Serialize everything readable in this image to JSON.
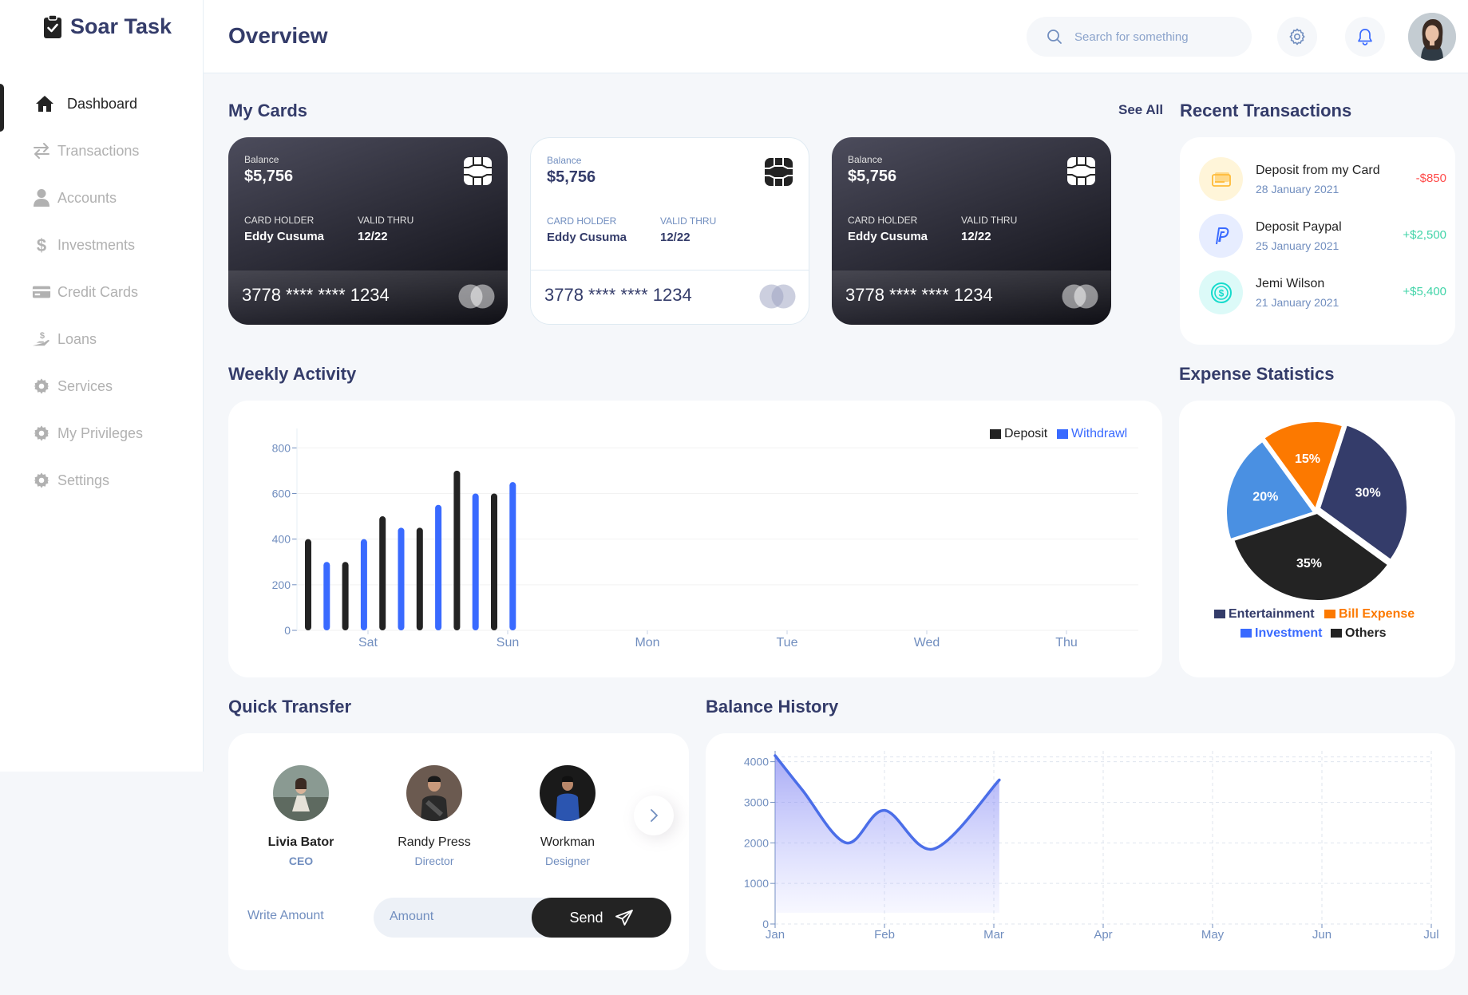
{
  "app": {
    "name": "Soar Task"
  },
  "sidebar": {
    "items": [
      {
        "label": "Dashboard",
        "icon": "home-icon",
        "active": true
      },
      {
        "label": "Transactions",
        "icon": "transfer-icon"
      },
      {
        "label": "Accounts",
        "icon": "user-icon"
      },
      {
        "label": "Investments",
        "icon": "dollar-icon"
      },
      {
        "label": "Credit Cards",
        "icon": "credit-card-icon"
      },
      {
        "label": "Loans",
        "icon": "loan-icon"
      },
      {
        "label": "Services",
        "icon": "gear-icon"
      },
      {
        "label": "My Privileges",
        "icon": "gear-icon"
      },
      {
        "label": "Settings",
        "icon": "gear-icon"
      }
    ]
  },
  "header": {
    "title": "Overview",
    "search_placeholder": "Search for something"
  },
  "my_cards": {
    "title": "My Cards",
    "see_all": "See All",
    "cards": [
      {
        "style": "dark",
        "balance_label": "Balance",
        "balance": "$5,756",
        "holder_label": "CARD HOLDER",
        "holder": "Eddy Cusuma",
        "valid_label": "VALID THRU",
        "valid": "12/22",
        "number": "3778 **** **** 1234"
      },
      {
        "style": "light",
        "balance_label": "Balance",
        "balance": "$5,756",
        "holder_label": "CARD HOLDER",
        "holder": "Eddy Cusuma",
        "valid_label": "VALID THRU",
        "valid": "12/22",
        "number": "3778 **** **** 1234"
      },
      {
        "style": "dark",
        "balance_label": "Balance",
        "balance": "$5,756",
        "holder_label": "CARD HOLDER",
        "holder": "Eddy Cusuma",
        "valid_label": "VALID THRU",
        "valid": "12/22",
        "number": "3778 **** **** 1234"
      }
    ]
  },
  "recent_transactions": {
    "title": "Recent Transactions",
    "items": [
      {
        "title": "Deposit from my Card",
        "date": "28 January 2021",
        "amount": "-$850",
        "type": "negative",
        "icon": "card-icon",
        "icon_bg": "#fff5d9",
        "icon_color": "#ffbb38"
      },
      {
        "title": "Deposit Paypal",
        "date": "25 January 2021",
        "amount": "+$2,500",
        "type": "positive",
        "icon": "paypal-icon",
        "icon_bg": "#e7edff",
        "icon_color": "#396aff"
      },
      {
        "title": "Jemi Wilson",
        "date": "21 January 2021",
        "amount": "+$5,400",
        "type": "positive",
        "icon": "coin-icon",
        "icon_bg": "#dcfaf8",
        "icon_color": "#16dbcc"
      }
    ]
  },
  "weekly_activity": {
    "title": "Weekly Activity"
  },
  "expense_statistics": {
    "title": "Expense Statistics"
  },
  "quick_transfer": {
    "title": "Quick Transfer",
    "people": [
      {
        "name": "Livia Bator",
        "role": "CEO",
        "selected": true
      },
      {
        "name": "Randy Press",
        "role": "Director"
      },
      {
        "name": "Workman",
        "role": "Designer"
      }
    ],
    "amount_label": "Write Amount",
    "amount_placeholder": "Amount",
    "send_label": "Send"
  },
  "balance_history": {
    "title": "Balance History"
  },
  "colors": {
    "deposit": "#232323",
    "withdrawl": "#396aff",
    "negative": "#ff4b4a",
    "positive": "#41d4a8",
    "entertainment": "#343c6a",
    "bill_expense": "#fc7900",
    "investment": "#396aff",
    "others": "#232323",
    "balance_line": "#4b6ee8"
  },
  "chart_data": [
    {
      "id": "weekly_activity",
      "type": "bar",
      "legend": [
        "Deposit",
        "Withdrawl"
      ],
      "legend_position": "top-right",
      "x_ticks": [
        "Sat",
        "Sun",
        "Mon",
        "Tue",
        "Wed",
        "Thu"
      ],
      "y_ticks": [
        0,
        200,
        400,
        600,
        800
      ],
      "ylim": [
        0,
        850
      ],
      "grid": true,
      "bars": [
        {
          "series": "Deposit",
          "value": 400
        },
        {
          "series": "Withdrawl",
          "value": 300
        },
        {
          "series": "Deposit",
          "value": 300
        },
        {
          "series": "Withdrawl",
          "value": 400
        },
        {
          "series": "Deposit",
          "value": 500
        },
        {
          "series": "Withdrawl",
          "value": 450
        },
        {
          "series": "Deposit",
          "value": 450
        },
        {
          "series": "Withdrawl",
          "value": 550
        },
        {
          "series": "Deposit",
          "value": 700
        },
        {
          "series": "Withdrawl",
          "value": 600
        },
        {
          "series": "Deposit",
          "value": 600
        },
        {
          "series": "Withdrawl",
          "value": 650
        }
      ]
    },
    {
      "id": "expense_statistics",
      "type": "pie",
      "legend_position": "bottom",
      "slices": [
        {
          "name": "Entertainment",
          "value": 30,
          "label": "30%"
        },
        {
          "name": "Others",
          "value": 35,
          "label": "35%"
        },
        {
          "name": "Investment",
          "value": 20,
          "label": "20%"
        },
        {
          "name": "Bill Expense",
          "value": 15,
          "label": "15%"
        }
      ],
      "legend": [
        "Entertainment",
        "Bill Expense",
        "Investment",
        "Others"
      ]
    },
    {
      "id": "balance_history",
      "type": "area",
      "x_ticks": [
        "Jan",
        "Feb",
        "Mar",
        "Apr",
        "May",
        "Jun",
        "Jul"
      ],
      "y_ticks": [
        0,
        1000,
        2000,
        3000,
        4000
      ],
      "ylim": [
        0,
        4150
      ],
      "grid": true,
      "points": [
        {
          "x": 0,
          "y": 4150
        },
        {
          "x": 0.25,
          "y": 3300
        },
        {
          "x": 0.65,
          "y": 2000
        },
        {
          "x": 1.0,
          "y": 2800
        },
        {
          "x": 1.45,
          "y": 1850
        },
        {
          "x": 2.05,
          "y": 3550
        }
      ]
    }
  ]
}
